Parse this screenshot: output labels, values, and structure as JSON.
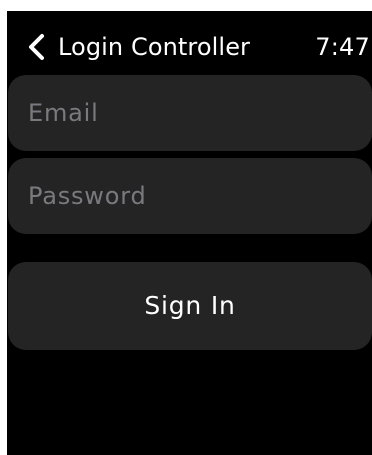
{
  "nav": {
    "back_icon": "chevron-left-icon",
    "title": "Login Controller",
    "time": "7:47"
  },
  "form": {
    "email_placeholder": "Email",
    "password_placeholder": "Password",
    "sign_in_label": "Sign In"
  },
  "colors": {
    "background": "#000000",
    "control": "#242425",
    "text": "#ffffff",
    "placeholder": "#7a7a7e"
  }
}
